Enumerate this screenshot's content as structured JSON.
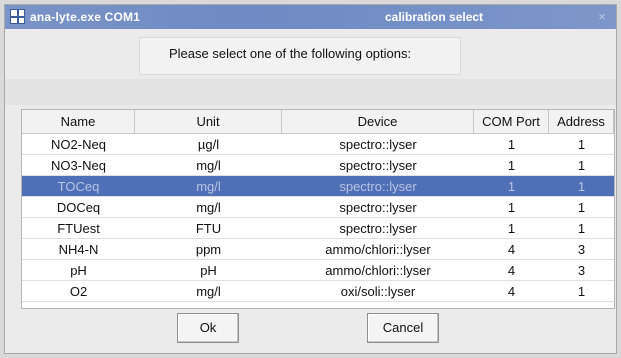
{
  "window": {
    "app_title": "ana-lyte.exe  COM1",
    "dialog_title": "calibration select",
    "close_glyph": "×"
  },
  "prompt": "Please select one of the following options:",
  "table": {
    "columns": [
      "Name",
      "Unit",
      "Device",
      "COM Port",
      "Address"
    ],
    "rows": [
      [
        "NO2-Neq",
        "µg/l",
        "spectro::lyser",
        "1",
        "1"
      ],
      [
        "NO3-Neq",
        "mg/l",
        "spectro::lyser",
        "1",
        "1"
      ],
      [
        "TOCeq",
        "mg/l",
        "spectro::lyser",
        "1",
        "1"
      ],
      [
        "DOCeq",
        "mg/l",
        "spectro::lyser",
        "1",
        "1"
      ],
      [
        "FTUest",
        "FTU",
        "spectro::lyser",
        "1",
        "1"
      ],
      [
        "NH4-N",
        "ppm",
        "ammo/chlori::lyser",
        "4",
        "3"
      ],
      [
        "pH",
        "pH",
        "ammo/chlori::lyser",
        "4",
        "3"
      ],
      [
        "O2",
        "mg/l",
        "oxi/soli::lyser",
        "4",
        "1"
      ]
    ],
    "selected_row": 2
  },
  "buttons": {
    "ok": "Ok",
    "cancel": "Cancel"
  },
  "colors": {
    "titlebar": "#7a94c8",
    "selection": "#4f6fb6"
  }
}
